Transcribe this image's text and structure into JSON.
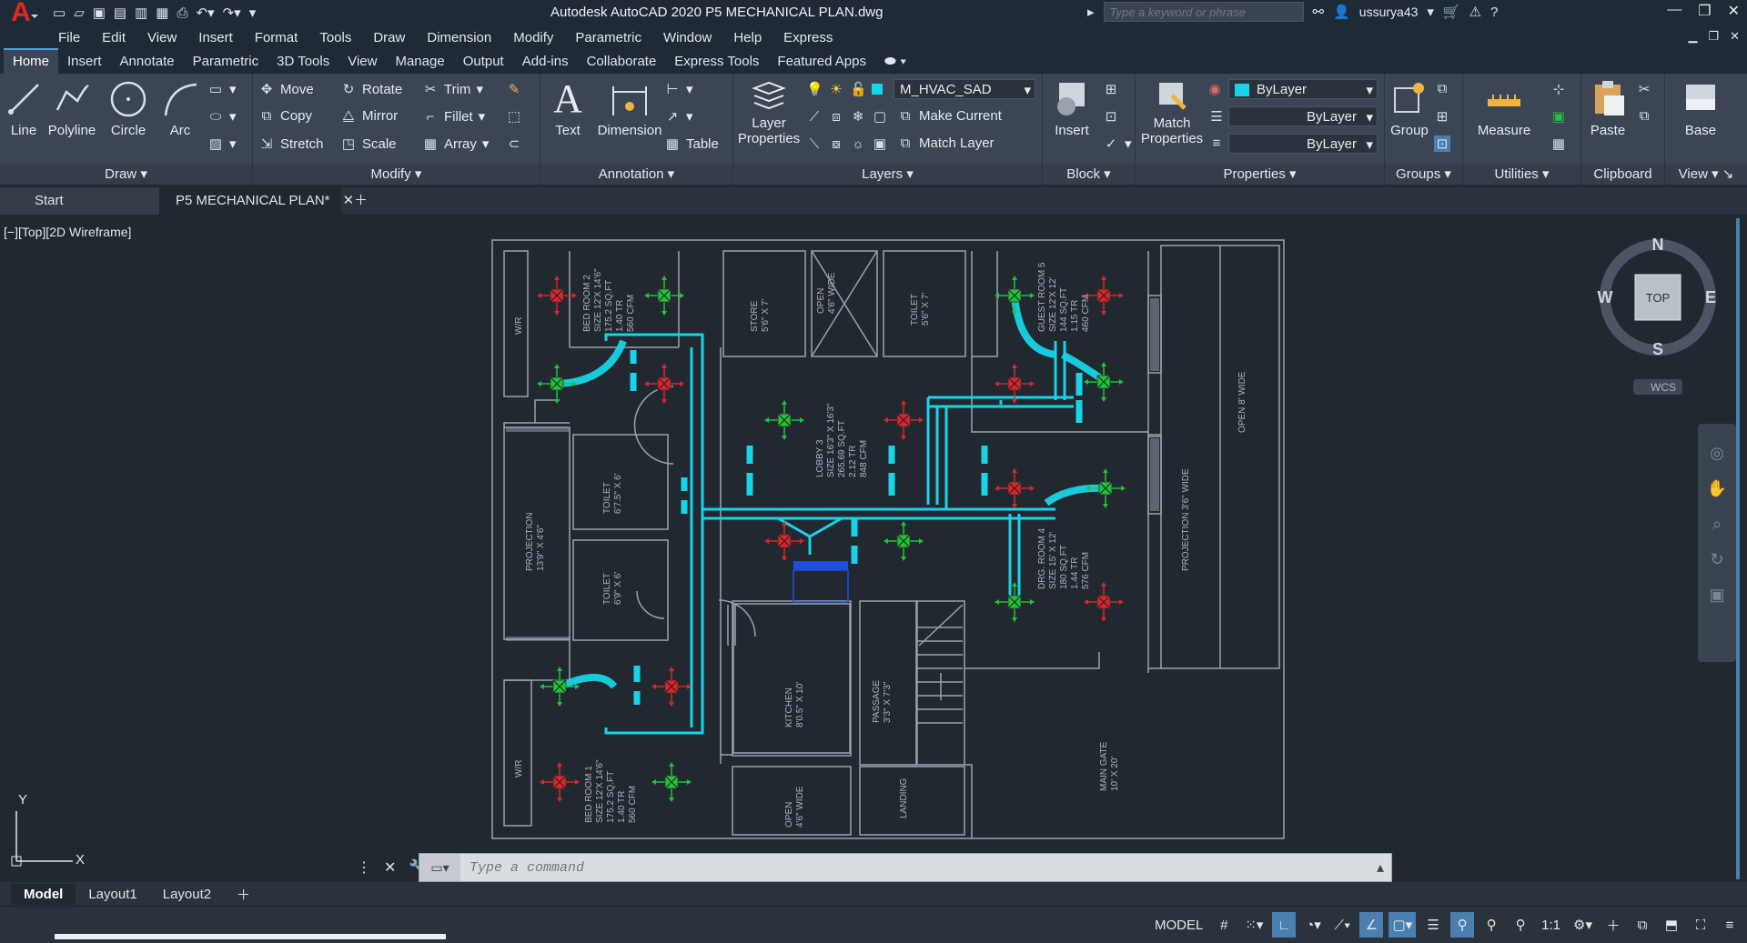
{
  "app": {
    "title": "Autodesk AutoCAD 2020   P5 MECHANICAL PLAN.dwg",
    "search_placeholder": "Type a keyword or phrase",
    "username": "ussurya43"
  },
  "menu": [
    "File",
    "Edit",
    "View",
    "Insert",
    "Format",
    "Tools",
    "Draw",
    "Dimension",
    "Modify",
    "Parametric",
    "Window",
    "Help",
    "Express"
  ],
  "ribbon_tabs": [
    "Home",
    "Insert",
    "Annotate",
    "Parametric",
    "3D Tools",
    "View",
    "Manage",
    "Output",
    "Add-ins",
    "Collaborate",
    "Express Tools",
    "Featured Apps"
  ],
  "ribbon": {
    "draw": {
      "title": "Draw",
      "line": "Line",
      "polyline": "Polyline",
      "circle": "Circle",
      "arc": "Arc"
    },
    "modify": {
      "title": "Modify",
      "move": "Move",
      "rotate": "Rotate",
      "trim": "Trim",
      "copy": "Copy",
      "mirror": "Mirror",
      "fillet": "Fillet",
      "stretch": "Stretch",
      "scale": "Scale",
      "array": "Array"
    },
    "annotation": {
      "title": "Annotation",
      "text": "Text",
      "dimension": "Dimension",
      "table": "Table"
    },
    "layers": {
      "title": "Layers",
      "layer_properties_1": "Layer",
      "layer_properties_2": "Properties",
      "current_layer": "M_HVAC_SAD",
      "make_current": "Make Current",
      "match_layer": "Match Layer"
    },
    "block": {
      "title": "Block",
      "insert": "Insert"
    },
    "properties": {
      "title": "Properties",
      "match_1": "Match",
      "match_2": "Properties",
      "color": "ByLayer",
      "linetype": "ByLayer",
      "lineweight": "ByLayer"
    },
    "groups": {
      "title": "Groups",
      "group": "Group"
    },
    "utilities": {
      "title": "Utilities",
      "measure": "Measure"
    },
    "clipboard": {
      "title": "Clipboard",
      "paste": "Paste"
    },
    "view": {
      "title": "View",
      "base": "Base"
    }
  },
  "doc_tabs": {
    "start": "Start",
    "current": "P5 MECHANICAL PLAN*"
  },
  "viewport_label": "[−][Top][2D Wireframe]",
  "viewcube": {
    "n": "N",
    "s": "S",
    "e": "E",
    "w": "W",
    "top": "TOP",
    "wcs": "WCS"
  },
  "ucs": {
    "x": "X",
    "y": "Y"
  },
  "drawing_labels": {
    "bed2": [
      "BED ROOM 2",
      "SIZE 12'X 14'6\"",
      "175.2 SQ.FT",
      "1.40 TR",
      "560 CFM"
    ],
    "wr_top": "W/R",
    "store": [
      "STORE",
      "5'6\" X 7'"
    ],
    "open_top": [
      "OPEN",
      "4'6\" WIDE"
    ],
    "toilet_top": [
      "TOILET",
      "5'6\" X 7'"
    ],
    "guest": [
      "GUEST ROOM 5",
      "SIZE 12'X 12'",
      "144 SQ.FT",
      "1.15 TR",
      "460 CFM"
    ],
    "projection_left": [
      "PROJECTION",
      "13'9\" X 4'6\""
    ],
    "toilet_a": [
      "TOILET",
      "6'7.5\" X 6'"
    ],
    "toilet_b": [
      "TOILET",
      "6'9\" X 6'"
    ],
    "lobby": [
      "LOBBY 3",
      "SIZE 16'3\" X 16'3\"",
      "265.69 SQ.FT",
      "2.12 TR",
      "848 CFM"
    ],
    "drg": [
      "DRG. ROOM 4",
      "SIZE 15' X 12'",
      "180 SQ.FT",
      "1.44 TR",
      "576 CFM"
    ],
    "projection_right": "PROJECTION 3'6\" WIDE",
    "open_right": "OPEN 8' WIDE",
    "kitchen": [
      "KITCHEN",
      "8'0.5\" X 10'"
    ],
    "passage": [
      "PASSAGE",
      "3'3\" X 7'3\""
    ],
    "main_gate": [
      "MAIN GATE",
      "10' X 20'"
    ],
    "wr_bottom": "W/R",
    "bed1": [
      "BED ROOM 1",
      "SIZE 12'X 14'6\"",
      "175.2 SQ.FT",
      "1.40 TR",
      "560 CFM"
    ],
    "open_bottom": [
      "OPEN",
      "4'6\" WIDE"
    ],
    "landing": "LANDING"
  },
  "command_placeholder": "Type a command",
  "layout_tabs": [
    "Model",
    "Layout1",
    "Layout2"
  ],
  "status": {
    "model": "MODEL",
    "scale": "1:1"
  },
  "colors": {
    "duct": "#19d3e6",
    "supply": "#22c23a",
    "return": "#d9262b",
    "wall": "#9aa3ad",
    "background": "#212830"
  }
}
